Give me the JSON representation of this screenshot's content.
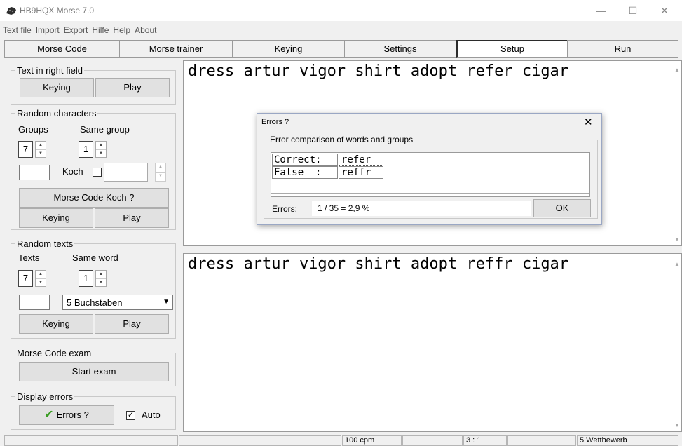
{
  "window": {
    "title": "HB9HQX Morse 7.0",
    "min_glyph": "—",
    "max_glyph": "☐",
    "close_glyph": "✕"
  },
  "menu": [
    "Text file",
    "Import",
    "Export",
    "Hilfe",
    "Help",
    "About"
  ],
  "tabs": [
    "Morse Code",
    "Morse trainer",
    "Keying",
    "Settings",
    "Setup",
    "Run"
  ],
  "active_tab": "Setup",
  "left_panel": {
    "text_in_right_field": {
      "title": "Text in right field",
      "keying": "Keying",
      "play": "Play"
    },
    "random_characters": {
      "title": "Random characters",
      "groups_label": "Groups",
      "groups_value": "7",
      "same_group_label": "Same group",
      "same_group_value": "1",
      "koch_label": "Koch",
      "koch_button": "Morse Code Koch ?",
      "keying": "Keying",
      "play": "Play"
    },
    "random_texts": {
      "title": "Random texts",
      "texts_label": "Texts",
      "texts_value": "7",
      "same_word_label": "Same word",
      "same_word_value": "1",
      "dropdown_value": "5 Buchstaben",
      "keying": "Keying",
      "play": "Play"
    },
    "morse_exam": {
      "title": "Morse Code exam",
      "start": "Start exam"
    },
    "display_errors": {
      "title": "Display errors",
      "errors_button": "Errors ?",
      "auto_label": "Auto",
      "auto_checked": true
    }
  },
  "top_pane_text": "dress artur vigor shirt adopt refer cigar",
  "bottom_pane_text": "dress artur vigor shirt adopt reffr cigar",
  "dialog": {
    "title": "Errors ?",
    "close": "✕",
    "group_title": "Error comparison of words and groups",
    "rows": [
      {
        "label": "Correct:",
        "value": "refer"
      },
      {
        "label": "False  :",
        "value": "reffr"
      }
    ],
    "errors_label": "Errors:",
    "errors_value": "1 / 35 = 2,9 %",
    "ok": "OK"
  },
  "status": {
    "speed": "100 cpm",
    "ratio": "3 : 1",
    "mode": "5 Wettbewerb"
  },
  "colors": {
    "check_green": "#3a9d23",
    "active_tab_border": "#2b2b2b",
    "dialog_border": "#9aa7c4"
  }
}
